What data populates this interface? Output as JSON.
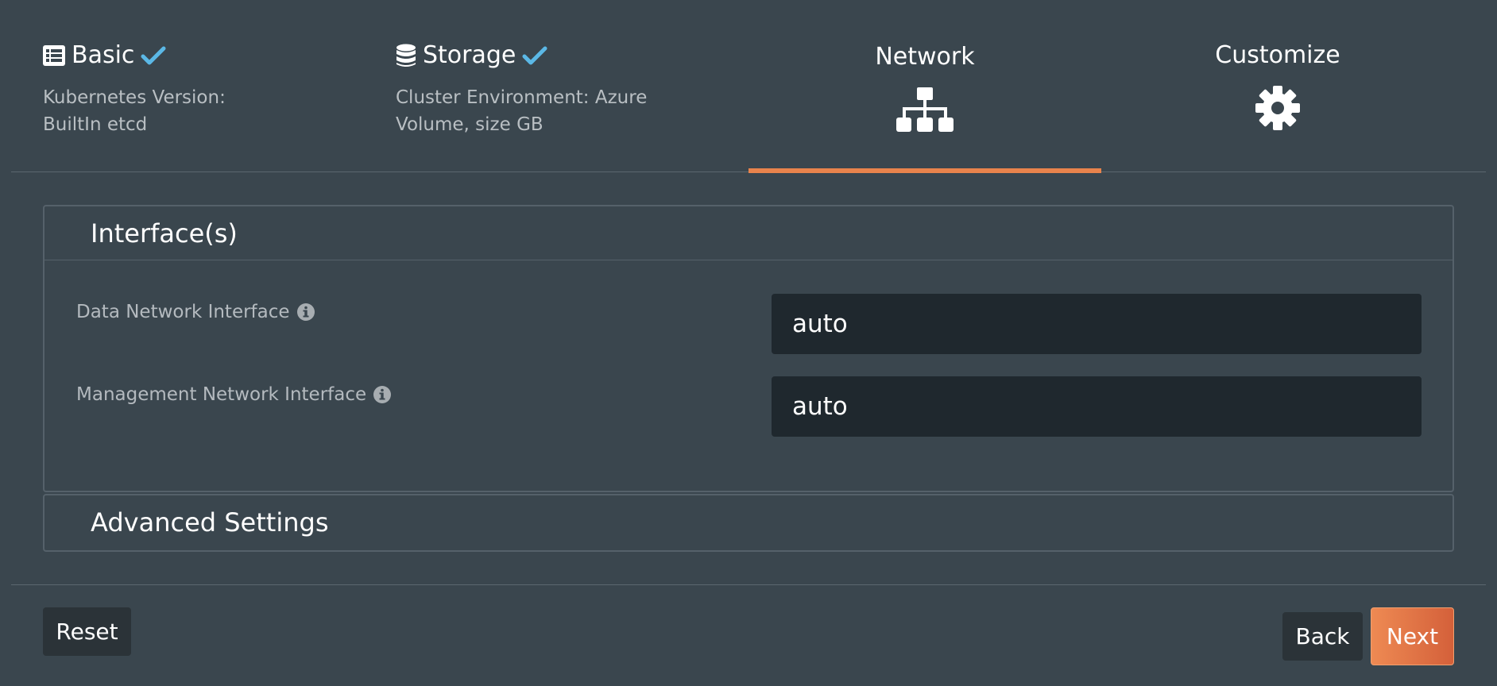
{
  "steps": [
    {
      "title": "Basic",
      "icon": "list-icon",
      "status": "complete",
      "desc_line1": "Kubernetes Version:",
      "desc_line2": "BuiltIn etcd"
    },
    {
      "title": "Storage",
      "icon": "database-icon",
      "status": "complete",
      "desc_line1": "Cluster Environment: Azure",
      "desc_line2": "Volume, size GB"
    },
    {
      "title": "Network",
      "icon": "sitemap-icon",
      "status": "active"
    },
    {
      "title": "Customize",
      "icon": "gear-icon",
      "status": "pending"
    }
  ],
  "interfaces": {
    "title": "Interface(s)",
    "data_label": "Data Network Interface",
    "data_value": "auto",
    "mgmt_label": "Management Network Interface",
    "mgmt_value": "auto"
  },
  "advanced": {
    "title": "Advanced Settings"
  },
  "footer": {
    "reset_label": "Reset",
    "back_label": "Back",
    "next_label": "Next"
  },
  "colors": {
    "background": "#3a464e",
    "accent": "#e8834c",
    "check": "#5bb8e6",
    "input_bg": "#1f282e"
  }
}
